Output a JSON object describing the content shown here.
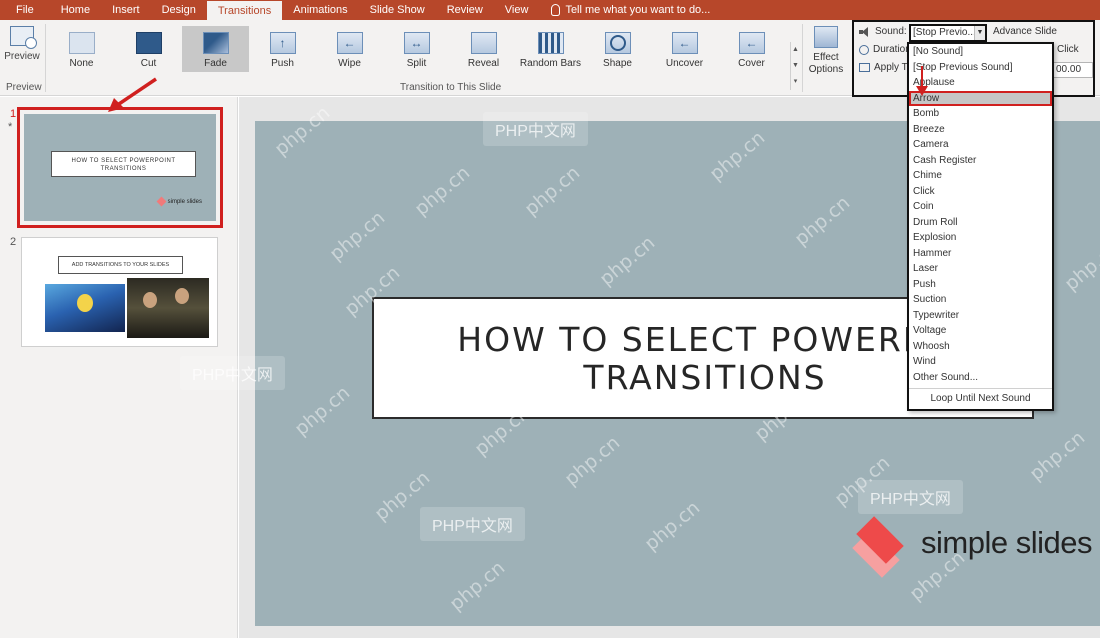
{
  "ribbon": {
    "tabs": [
      {
        "label": "File",
        "active": false
      },
      {
        "label": "Home",
        "active": false
      },
      {
        "label": "Insert",
        "active": false
      },
      {
        "label": "Design",
        "active": false
      },
      {
        "label": "Transitions",
        "active": true
      },
      {
        "label": "Animations",
        "active": false
      },
      {
        "label": "Slide Show",
        "active": false
      },
      {
        "label": "Review",
        "active": false
      },
      {
        "label": "View",
        "active": false
      }
    ],
    "tell_me": "Tell me what you want to do...",
    "preview_label": "Preview",
    "preview_group": "Preview",
    "transitions": [
      {
        "label": "None",
        "icon": "none-transition-icon"
      },
      {
        "label": "Cut",
        "icon": "cut-transition-icon"
      },
      {
        "label": "Fade",
        "icon": "fade-transition-icon",
        "selected": true
      },
      {
        "label": "Push",
        "icon": "push-transition-icon"
      },
      {
        "label": "Wipe",
        "icon": "wipe-transition-icon"
      },
      {
        "label": "Split",
        "icon": "split-transition-icon"
      },
      {
        "label": "Reveal",
        "icon": "reveal-transition-icon"
      },
      {
        "label": "Random Bars",
        "icon": "random-bars-transition-icon"
      },
      {
        "label": "Shape",
        "icon": "shape-transition-icon"
      },
      {
        "label": "Uncover",
        "icon": "uncover-transition-icon"
      },
      {
        "label": "Cover",
        "icon": "cover-transition-icon"
      }
    ],
    "transition_group": "Transition to This Slide",
    "effect_options": "Effect Options",
    "timing": {
      "sound_label": "Sound:",
      "sound_value": "[Stop Previo...",
      "advance_label": "Advance Slide",
      "duration_label": "Duration",
      "apply_label": "Apply To",
      "click_label": "Click",
      "time_value": "00.00"
    }
  },
  "sound_menu": {
    "items": [
      "[No Sound]",
      "[Stop Previous Sound]",
      "Applause",
      "Arrow",
      "Bomb",
      "Breeze",
      "Camera",
      "Cash Register",
      "Chime",
      "Click",
      "Coin",
      "Drum Roll",
      "Explosion",
      "Hammer",
      "Laser",
      "Push",
      "Suction",
      "Typewriter",
      "Voltage",
      "Whoosh",
      "Wind",
      "Other Sound..."
    ],
    "highlighted": "Arrow",
    "loop_label": "Loop Until Next Sound"
  },
  "thumbnails": [
    {
      "number": "1",
      "marker": "*",
      "title": "HOW TO SELECT POWERPOINT TRANSITIONS",
      "logo": "simple slides"
    },
    {
      "number": "2",
      "title": "ADD TRANSITIONS TO YOUR SLIDES"
    }
  ],
  "slide": {
    "title": "HOW TO SELECT POWERPO\nTRANSITIONS",
    "logo_text": "simple slides"
  },
  "watermarks": {
    "site": "php.cn",
    "box": "PHP中文网"
  },
  "colors": {
    "ribbon_accent": "#b7472a",
    "slide_bg": "#9eb1b7",
    "highlight_red": "#d0201f",
    "logo_red": "#ee4a4a"
  }
}
